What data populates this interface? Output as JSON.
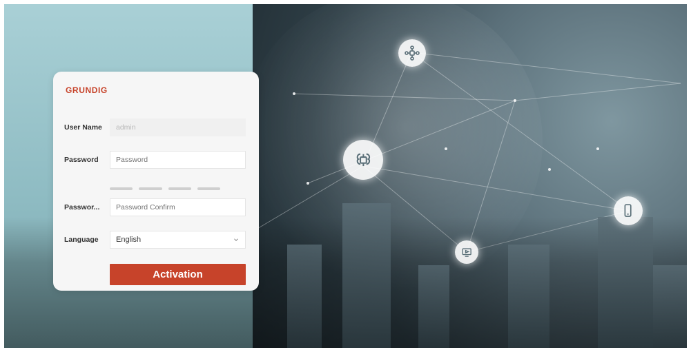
{
  "brand": {
    "logo_text": "GRUNDIG"
  },
  "form": {
    "user_name": {
      "label": "User Name",
      "value": "admin"
    },
    "password": {
      "label": "Password",
      "placeholder": "Password"
    },
    "password_confirm": {
      "label": "Passwor...",
      "placeholder": "Password Confirm"
    },
    "language": {
      "label": "Language",
      "selected": "English"
    },
    "activation_button": {
      "label": "Activation"
    }
  },
  "icons": {
    "network_node": "network-node-icon",
    "brain_chip": "brain-chip-icon",
    "phone": "phone-icon",
    "display": "display-icon"
  },
  "colors": {
    "accent": "#c7432a",
    "panel_bg": "#f6f6f6"
  }
}
